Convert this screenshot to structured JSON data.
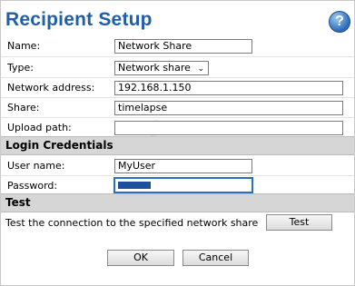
{
  "dialog": {
    "title": "Recipient Setup",
    "help_glyph": "?"
  },
  "fields": {
    "name": {
      "label": "Name:",
      "value": "Network Share"
    },
    "type": {
      "label": "Type:",
      "value": "Network share"
    },
    "network_address": {
      "label": "Network address:",
      "value": "192.168.1.150"
    },
    "share": {
      "label": "Share:",
      "value": "timelapse"
    },
    "upload_path": {
      "label": "Upload path:",
      "value": ""
    }
  },
  "login": {
    "section_title": "Login Credentials",
    "username": {
      "label": "User name:",
      "value": "MyUser"
    },
    "password": {
      "label": "Password:",
      "masked_length": 6
    }
  },
  "test": {
    "section_title": "Test",
    "description": "Test the connection to the specified network share",
    "button_label": "Test"
  },
  "actions": {
    "ok_label": "OK",
    "cancel_label": "Cancel"
  },
  "colors": {
    "title": "#1f5ea8",
    "section_bg": "#d6d6d6",
    "focus": "#2d6fbf"
  }
}
